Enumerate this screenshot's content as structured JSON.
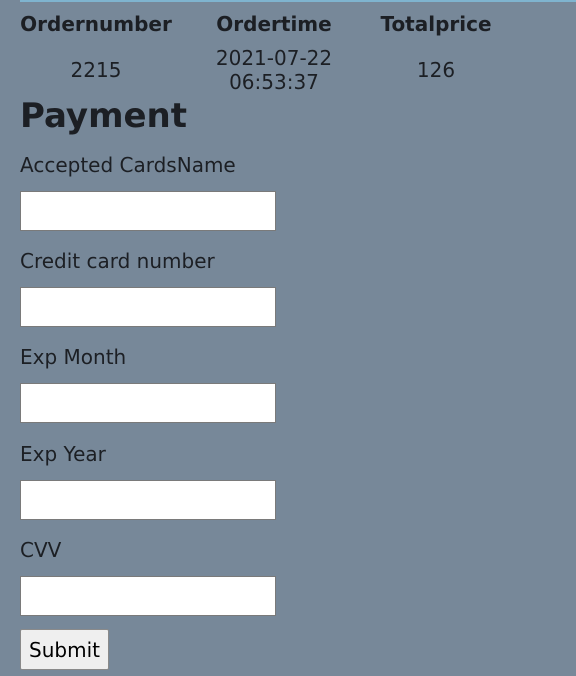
{
  "orders_table": {
    "headers": [
      "Ordernumber",
      "Ordertime",
      "Totalprice"
    ],
    "rows": [
      [
        "2215",
        "2021-07-22 06:53:37",
        "126"
      ]
    ]
  },
  "payment": {
    "title": "Payment",
    "fields": [
      {
        "label": "Accepted CardsName",
        "value": ""
      },
      {
        "label": "Credit card number",
        "value": ""
      },
      {
        "label": "Exp Month",
        "value": ""
      },
      {
        "label": "Exp Year",
        "value": ""
      },
      {
        "label": "CVV",
        "value": ""
      }
    ],
    "submit_label": "Submit"
  },
  "colors": {
    "background": "#778899",
    "input_background": "#ffffff",
    "accent_line": "#7fb4cf"
  }
}
